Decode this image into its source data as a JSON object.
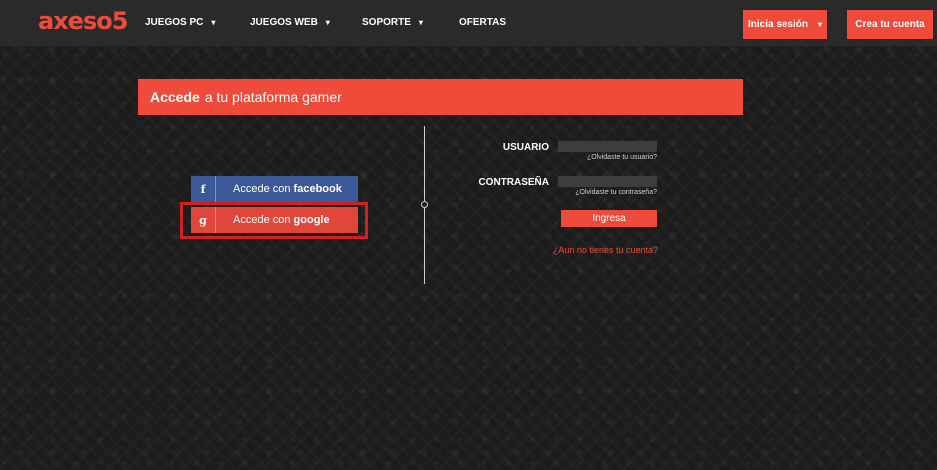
{
  "header": {
    "logo": "axeso5",
    "nav": [
      {
        "label": "JUEGOS PC",
        "caret": "▾"
      },
      {
        "label": "JUEGOS WEB",
        "caret": "▾"
      },
      {
        "label": "SOPORTE",
        "caret": "▾"
      },
      {
        "label": "OFERTAS"
      }
    ],
    "login_label": "Inicia sesión",
    "login_caret": "▾",
    "register_label": "Crea tu cuenta"
  },
  "banner": {
    "strong": "Accede",
    "rest": "a tu plataforma gamer"
  },
  "social": {
    "facebook": {
      "icon": "f",
      "prefix": "Accede con",
      "brand": "facebook"
    },
    "google": {
      "icon": "g",
      "prefix": "Accede con",
      "brand": "google"
    }
  },
  "form": {
    "username_label": "USUARIO",
    "username_value": "",
    "forgot_username": "¿Olvidaste tu usuario?",
    "password_label": "CONTRASEÑA",
    "password_value": "",
    "forgot_password": "¿Olvidaste tu contraseña?",
    "submit_label": "Ingresa",
    "no_account": "¿Aun no tienes tu cuenta?"
  },
  "colors": {
    "accent": "#f04b3a",
    "facebook": "#3b5998",
    "google": "#e0463a",
    "highlight": "#d41f1f"
  }
}
